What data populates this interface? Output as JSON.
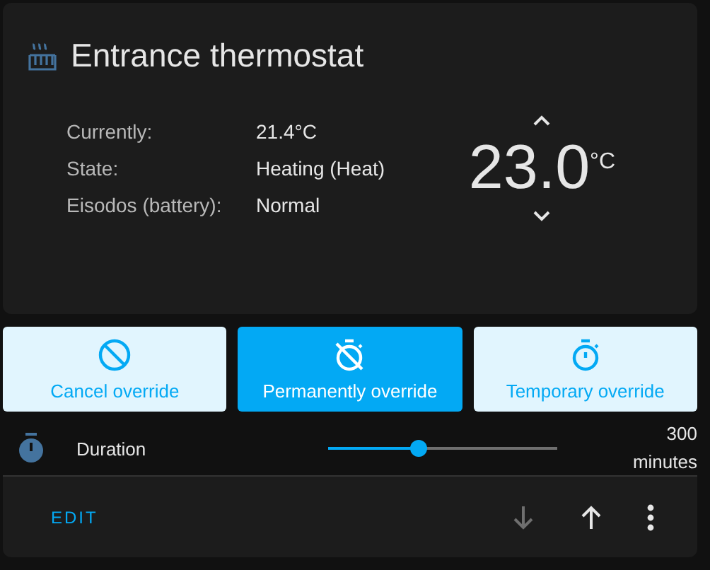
{
  "card": {
    "title": "Entrance thermostat",
    "attributes": [
      {
        "label": "Currently:",
        "value": "21.4°C"
      },
      {
        "label": "State:",
        "value": "Heating (Heat)"
      },
      {
        "label": "Eisodos (battery):",
        "value": "Normal"
      }
    ],
    "target": {
      "value": "23.0",
      "unit": "°C"
    }
  },
  "buttons": [
    {
      "label": "Cancel override",
      "kind": "cancel",
      "selected": false
    },
    {
      "label": "Permanently override",
      "kind": "permanent",
      "selected": true
    },
    {
      "label": "Temporary override",
      "kind": "temporary",
      "selected": false
    }
  ],
  "duration": {
    "label": "Duration",
    "level": 0.4,
    "reading": [
      "300",
      "minutes"
    ]
  },
  "footer": {
    "edit": "EDIT",
    "move_down": {
      "disabled": true
    },
    "move_up": {
      "disabled": false
    }
  }
}
